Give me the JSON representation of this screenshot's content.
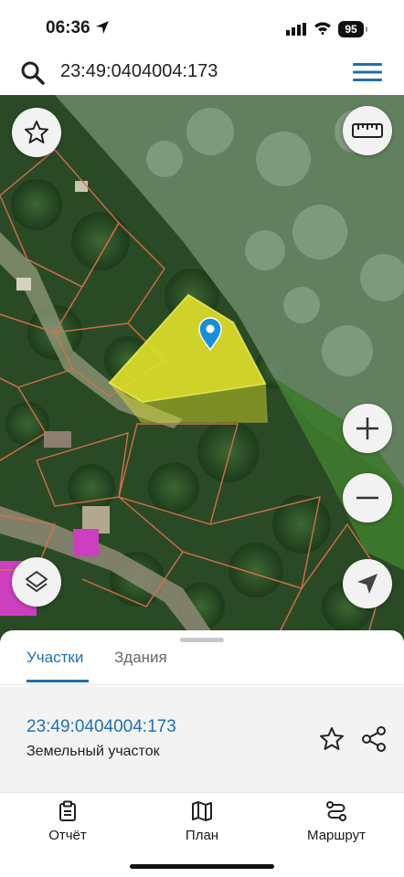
{
  "status": {
    "time": "06:36",
    "battery": "95"
  },
  "search": {
    "query": "23:49:0404004:173"
  },
  "icons": {
    "search": "search-icon",
    "menu": "hamburger-menu-icon",
    "favorite": "star-outline-icon",
    "ruler": "ruler-icon",
    "zoom_in": "plus-icon",
    "zoom_out": "minus-icon",
    "layers": "layers-icon",
    "locate": "navigation-arrow-icon",
    "pin": "map-pin-icon",
    "share": "share-icon",
    "report": "clipboard-icon",
    "plan": "map-icon",
    "route": "route-icon"
  },
  "colors": {
    "accent": "#1f6fb4",
    "parcel_fill": "#e2e22a",
    "boundary": "#d9704a",
    "pin": "#1b8fd6"
  },
  "tabs": [
    {
      "label": "Участки",
      "active": true
    },
    {
      "label": "Здания",
      "active": false
    }
  ],
  "parcel": {
    "id": "23:49:0404004:173",
    "type": "Земельный участок"
  },
  "nav": [
    {
      "label": "Отчёт"
    },
    {
      "label": "План"
    },
    {
      "label": "Маршрут"
    }
  ]
}
